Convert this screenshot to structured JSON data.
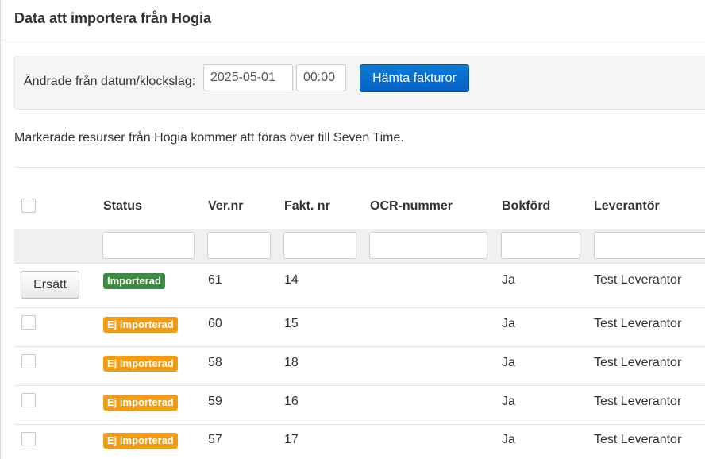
{
  "header": {
    "title": "Data att importera från Hogia"
  },
  "filter": {
    "label": "Ändrade från datum/klockslag:",
    "date_value": "2025-05-01",
    "time_value": "00:00",
    "fetch_label": "Hämta fakturor"
  },
  "info": "Markerade resurser från Hogia kommer att föras över till Seven Time.",
  "table": {
    "columns": [
      "Status",
      "Ver.nr",
      "Fakt. nr",
      "OCR-nummer",
      "Bokförd",
      "Leverantör"
    ],
    "rows": [
      {
        "action": "Ersätt",
        "status": "Importerad",
        "ver": "61",
        "fakt": "14",
        "ocr": "",
        "bokford": "Ja",
        "leverantor": "Test Leverantor"
      },
      {
        "action": "",
        "status": "Ej importerad",
        "ver": "60",
        "fakt": "15",
        "ocr": "",
        "bokford": "Ja",
        "leverantor": "Test Leverantor"
      },
      {
        "action": "",
        "status": "Ej importerad",
        "ver": "58",
        "fakt": "18",
        "ocr": "",
        "bokford": "Ja",
        "leverantor": "Test Leverantor"
      },
      {
        "action": "",
        "status": "Ej importerad",
        "ver": "59",
        "fakt": "16",
        "ocr": "",
        "bokford": "Ja",
        "leverantor": "Test Leverantor"
      },
      {
        "action": "",
        "status": "Ej importerad",
        "ver": "57",
        "fakt": "17",
        "ocr": "",
        "bokford": "Ja",
        "leverantor": "Test Leverantor"
      }
    ]
  },
  "colors": {
    "primary": "#0761c4",
    "success": "#3c8b43",
    "warning": "#f39b12"
  }
}
